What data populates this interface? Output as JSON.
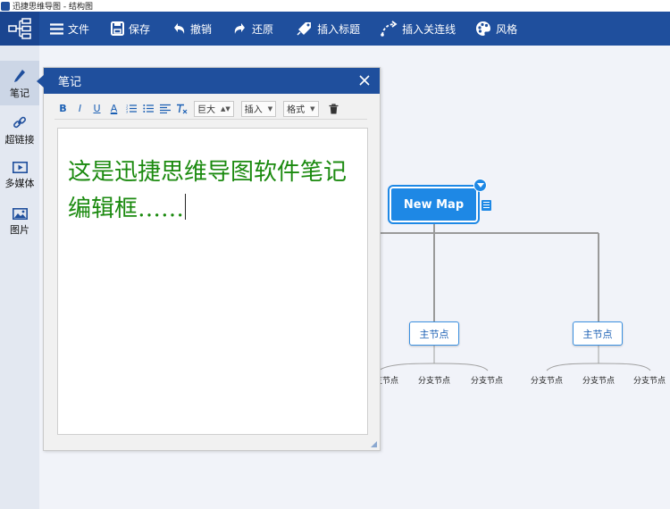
{
  "window": {
    "title": "迅捷思维导图 - 结构图"
  },
  "toolbar": {
    "file": "文件",
    "save": "保存",
    "undo": "撤销",
    "redo": "还原",
    "insert_title": "插入标题",
    "insert_relation": "插入关连线",
    "style": "风格"
  },
  "sidebar": {
    "items": [
      {
        "label": "笔记",
        "icon": "pencil-icon"
      },
      {
        "label": "超链接",
        "icon": "link-icon"
      },
      {
        "label": "多媒体",
        "icon": "media-icon"
      },
      {
        "label": "图片",
        "icon": "image-icon"
      }
    ]
  },
  "note": {
    "title": "笔记",
    "toolbar": {
      "bold": "B",
      "italic": "I",
      "underline": "U",
      "font_color": "A",
      "size_value": "巨大",
      "insert_value": "插入",
      "format_value": "格式"
    },
    "content": "这是迅捷思维导图软件笔记编辑框……"
  },
  "mindmap": {
    "root": "New Map",
    "main_nodes": [
      "主节点",
      "主节点"
    ],
    "sub_nodes": [
      "分支节点",
      "分支节点",
      "分支节点",
      "分支节点",
      "分支节点",
      "分支节点"
    ]
  },
  "colors": {
    "toolbar_bg": "#1f4f9d",
    "root_node": "#1e88e5",
    "note_text": "#1b8a0f",
    "canvas_bg": "#f1f3f9"
  }
}
